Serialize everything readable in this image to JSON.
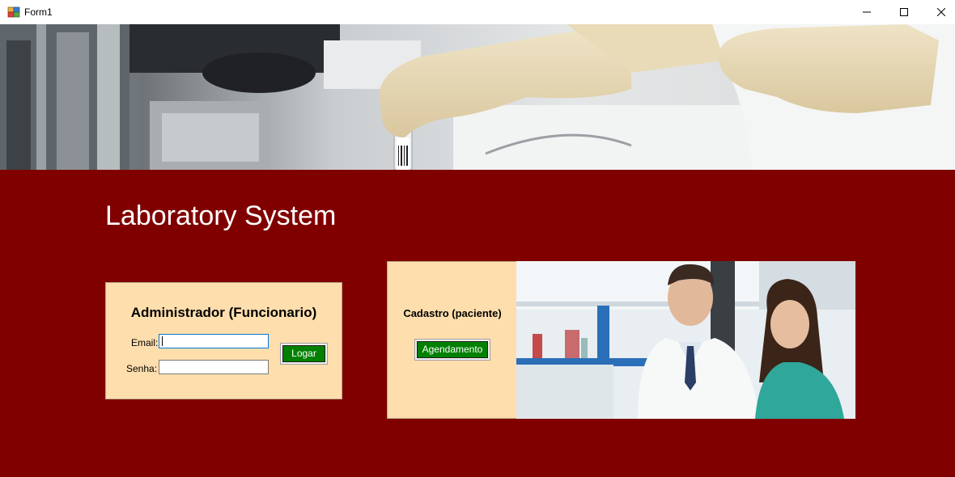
{
  "window": {
    "title": "Form1",
    "app_icon": "winforms-app-icon",
    "controls": {
      "minimize": "minimize-icon",
      "maximize": "maximize-icon",
      "close": "close-icon"
    }
  },
  "banner": {
    "image": "laboratory-gloved-hands-test-tube-photo"
  },
  "main": {
    "title": "Laboratory System",
    "background_color": "#800000"
  },
  "login": {
    "heading": "Administrador (Funcionario)",
    "email_label": "Email:",
    "email_value": "",
    "senha_label": "Senha:",
    "senha_value": "",
    "button_label": "Logar",
    "panel_color": "#ffdead",
    "button_color": "#008000"
  },
  "cadastro": {
    "heading": "Cadastro (paciente)",
    "button_label": "Agendamento",
    "photo": "doctor-and-patient-photo"
  }
}
